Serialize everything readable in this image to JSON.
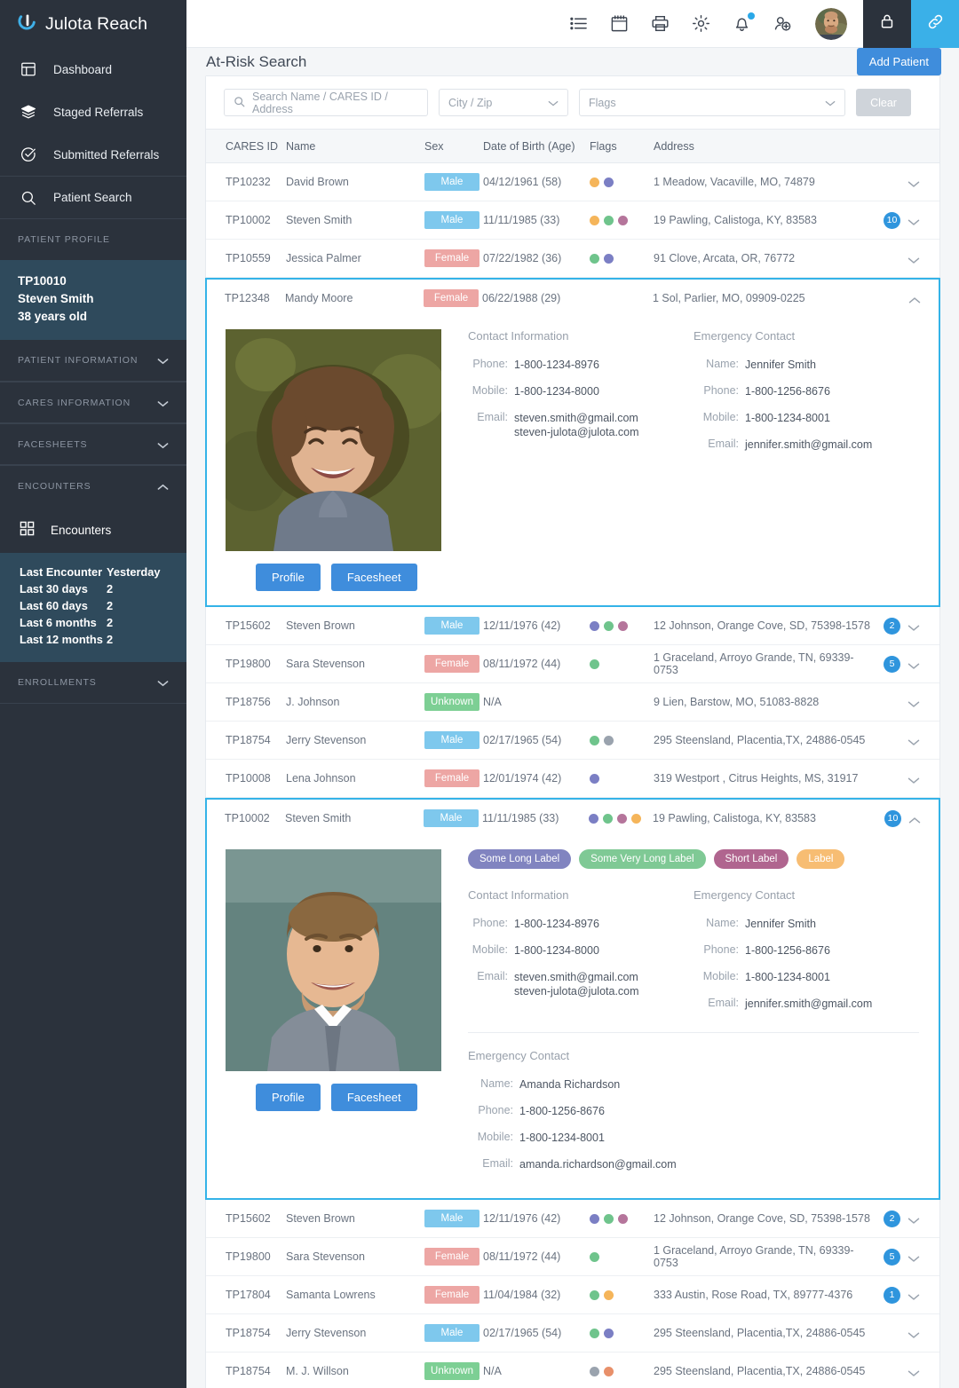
{
  "brand": {
    "name": "Julota Reach",
    "logo_icon": "julota-u-logo"
  },
  "sidebar": {
    "nav": [
      {
        "label": "Dashboard",
        "icon": "dashboard-icon"
      },
      {
        "label": "Staged Referrals",
        "icon": "layers-icon"
      },
      {
        "label": "Submitted Referrals",
        "icon": "check-circle-icon"
      },
      {
        "label": "Patient Search",
        "icon": "search-icon"
      }
    ],
    "patient_profile_header": "PATIENT PROFILE",
    "patient": {
      "id": "TP10010",
      "name": "Steven Smith",
      "age": "38 years old"
    },
    "sections": [
      {
        "label": "PATIENT INFORMATION",
        "expanded": false
      },
      {
        "label": "CARES INFORMATION",
        "expanded": false
      },
      {
        "label": "FACESHEETS",
        "expanded": false
      },
      {
        "label": "ENCOUNTERS",
        "expanded": true
      }
    ],
    "encounters_link": {
      "label": "Encounters",
      "icon": "grid-icon"
    },
    "encounter_stats": [
      {
        "label": "Last Encounter",
        "value": "Yesterday"
      },
      {
        "label": "Last 30 days",
        "value": "2"
      },
      {
        "label": "Last 60 days",
        "value": "2"
      },
      {
        "label": "Last 6 months",
        "value": "2"
      },
      {
        "label": "Last 12 months",
        "value": "2"
      }
    ],
    "enrollments": {
      "label": "ENROLLMENTS",
      "expanded": false
    }
  },
  "topbar": {
    "icons": [
      "list-icon",
      "calendar-icon",
      "printer-icon",
      "gear-icon",
      "bell-icon",
      "add-user-icon"
    ],
    "avatar": "user-avatar",
    "lock_icon": "lock-icon",
    "link_icon": "link-icon",
    "notification_dot": true
  },
  "header": {
    "title": "At-Risk Search",
    "add_patient_label": "Add Patient"
  },
  "filters": {
    "search_placeholder": "Search Name / CARES ID / Address",
    "city_zip_placeholder": "City / Zip",
    "flags_placeholder": "Flags",
    "clear_label": "Clear"
  },
  "table": {
    "columns": [
      "CARES ID",
      "Name",
      "Sex",
      "Date of Birth (Age)",
      "Flags",
      "Address"
    ],
    "rows": [
      {
        "id": "TP10232",
        "name": "David Brown",
        "sex": "Male",
        "dob": "04/12/1961 (58)",
        "flags": [
          "orange",
          "purple"
        ],
        "address": "1 Meadow, Vacaville, MO, 74879",
        "count": "",
        "expanded": false
      },
      {
        "id": "TP10002",
        "name": "Steven Smith",
        "sex": "Male",
        "dob": "11/11/1985 (33)",
        "flags": [
          "orange",
          "green",
          "mauve"
        ],
        "address": "19 Pawling, Calistoga, KY, 83583",
        "count": "10",
        "expanded": false
      },
      {
        "id": "TP10559",
        "name": "Jessica Palmer",
        "sex": "Female",
        "dob": "07/22/1982 (36)",
        "flags": [
          "green",
          "purple"
        ],
        "address": "91 Clove, Arcata, OR, 76772",
        "count": "",
        "expanded": false
      },
      {
        "id": "TP12348",
        "name": "Mandy Moore",
        "sex": "Female",
        "dob": "06/22/1988 (29)",
        "flags": [],
        "address": "1 Sol, Parlier, MO, 09909-0225",
        "count": "",
        "expanded": true,
        "detail_key": "mandy"
      },
      {
        "id": "TP15602",
        "name": "Steven Brown",
        "sex": "Male",
        "dob": "12/11/1976 (42)",
        "flags": [
          "purple",
          "green",
          "mauve"
        ],
        "address": "12 Johnson, Orange Cove, SD, 75398-1578",
        "count": "2",
        "expanded": false
      },
      {
        "id": "TP19800",
        "name": "Sara Stevenson",
        "sex": "Female",
        "dob": "08/11/1972 (44)",
        "flags": [
          "green"
        ],
        "address": "1 Graceland, Arroyo Grande, TN, 69339-0753",
        "count": "5",
        "expanded": false
      },
      {
        "id": "TP18756",
        "name": "J. Johnson",
        "sex": "Unknown",
        "dob": "N/A",
        "flags": [],
        "address": "9 Lien, Barstow, MO, 51083-8828",
        "count": "",
        "expanded": false
      },
      {
        "id": "TP18754",
        "name": "Jerry Stevenson",
        "sex": "Male",
        "dob": "02/17/1965 (54)",
        "flags": [
          "green",
          "gray"
        ],
        "address": "295 Steensland, Placentia,TX, 24886-0545",
        "count": "",
        "expanded": false
      },
      {
        "id": "TP10008",
        "name": "Lena Johnson",
        "sex": "Female",
        "dob": "12/01/1974 (42)",
        "flags": [
          "purple"
        ],
        "address": "319 Westport , Citrus Heights, MS, 31917",
        "count": "",
        "expanded": false
      },
      {
        "id": "TP10002",
        "name": "Steven Smith",
        "sex": "Male",
        "dob": "11/11/1985 (33)",
        "flags": [
          "purple",
          "green",
          "mauve",
          "orange"
        ],
        "address": "19 Pawling, Calistoga, KY, 83583",
        "count": "10",
        "expanded": true,
        "detail_key": "steven"
      },
      {
        "id": "TP15602",
        "name": "Steven Brown",
        "sex": "Male",
        "dob": "12/11/1976 (42)",
        "flags": [
          "purple",
          "green",
          "mauve"
        ],
        "address": "12 Johnson, Orange Cove, SD, 75398-1578",
        "count": "2",
        "expanded": false
      },
      {
        "id": "TP19800",
        "name": "Sara Stevenson",
        "sex": "Female",
        "dob": "08/11/1972 (44)",
        "flags": [
          "green"
        ],
        "address": "1 Graceland, Arroyo Grande, TN, 69339-0753",
        "count": "5",
        "expanded": false
      },
      {
        "id": "TP17804",
        "name": "Samanta Lowrens",
        "sex": "Female",
        "dob": "11/04/1984 (32)",
        "flags": [
          "green",
          "orange"
        ],
        "address": "333 Austin, Rose Road, TX, 89777-4376",
        "count": "1",
        "expanded": false
      },
      {
        "id": "TP18754",
        "name": "Jerry Stevenson",
        "sex": "Male",
        "dob": "02/17/1965 (54)",
        "flags": [
          "green",
          "purple"
        ],
        "address": "295 Steensland, Placentia,TX, 24886-0545",
        "count": "",
        "expanded": false
      },
      {
        "id": "TP18754",
        "name": "M. J. Willson",
        "sex": "Unknown",
        "dob": "N/A",
        "flags": [
          "gray",
          "salmon"
        ],
        "address": "295 Steensland, Placentia,TX, 24886-0545",
        "count": "",
        "expanded": false
      }
    ]
  },
  "details": {
    "mandy": {
      "photo": "mandy-moore-photo",
      "profile_label": "Profile",
      "facesheet_label": "Facesheet",
      "pills": [],
      "contact_heading": "Contact Information",
      "contact": [
        {
          "k": "Phone:",
          "v": "1-800-1234-8976"
        },
        {
          "k": "Mobile:",
          "v": "1-800-1234-8000"
        },
        {
          "k": "Email:",
          "v": "steven.smith@gmail.com\nsteven-julota@julota.com"
        }
      ],
      "emergency_heading": "Emergency Contact",
      "emergency": [
        {
          "k": "Name:",
          "v": "Jennifer Smith"
        },
        {
          "k": "Phone:",
          "v": "1-800-1256-8676"
        },
        {
          "k": "Mobile:",
          "v": "1-800-1234-8001"
        },
        {
          "k": "Email:",
          "v": "jennifer.smith@gmail.com"
        }
      ],
      "second_emergency": null
    },
    "steven": {
      "photo": "steven-smith-photo",
      "profile_label": "Profile",
      "facesheet_label": "Facesheet",
      "pills": [
        {
          "text": "Some Long Label",
          "color": "#8184c0"
        },
        {
          "text": "Some Very Long Label",
          "color": "#7fc995"
        },
        {
          "text": "Short Label",
          "color": "#b0658f"
        },
        {
          "text": "Label",
          "color": "#f7bd73"
        }
      ],
      "contact_heading": "Contact Information",
      "contact": [
        {
          "k": "Phone:",
          "v": "1-800-1234-8976"
        },
        {
          "k": "Mobile:",
          "v": "1-800-1234-8000"
        },
        {
          "k": "Email:",
          "v": "steven.smith@gmail.com\nsteven-julota@julota.com"
        }
      ],
      "emergency_heading": "Emergency Contact",
      "emergency": [
        {
          "k": "Name:",
          "v": "Jennifer Smith"
        },
        {
          "k": "Phone:",
          "v": "1-800-1256-8676"
        },
        {
          "k": "Mobile:",
          "v": "1-800-1234-8001"
        },
        {
          "k": "Email:",
          "v": "jennifer.smith@gmail.com"
        }
      ],
      "second_emergency": {
        "heading": "Emergency Contact",
        "rows": [
          {
            "k": "Name:",
            "v": "Amanda Richardson"
          },
          {
            "k": "Phone:",
            "v": "1-800-1256-8676"
          },
          {
            "k": "Mobile:",
            "v": "1-800-1234-8001"
          },
          {
            "k": "Email:",
            "v": "amanda.richardson@gmail.com"
          }
        ]
      }
    }
  },
  "colors": {
    "accent_blue": "#3f8ddc",
    "highlight_blue": "#34b3e8",
    "sidebar_bg": "#2b323c",
    "patient_card_bg": "#2f4a5c",
    "male": "#7ec8ed",
    "female": "#eda6a4",
    "unknown": "#7dcf94",
    "flag_orange": "#f5b55a",
    "flag_purple": "#7b7fc4",
    "flag_green": "#6fc48c",
    "flag_mauve": "#b5759b",
    "flag_gray": "#9aa3ae",
    "flag_salmon": "#e8906a"
  }
}
